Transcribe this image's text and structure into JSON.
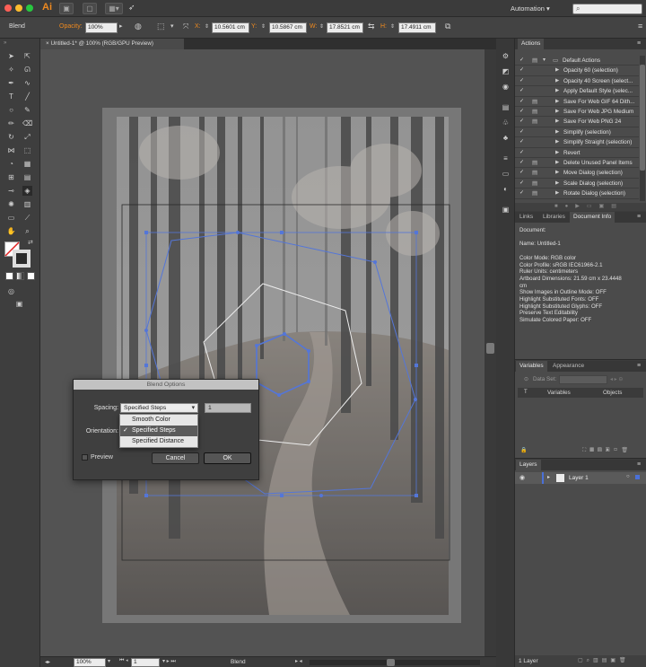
{
  "menubar": {
    "app_icon": "Ai",
    "workspace": "Automation",
    "search_placeholder": "",
    "traffic_colors": [
      "#fc5f57",
      "#fdbc2e",
      "#28c840"
    ]
  },
  "control_bar": {
    "object_type": "Blend",
    "opacity_label": "Opacity:",
    "opacity_value": "100%",
    "x_label": "X:",
    "x_value": "10.5601 cm",
    "y_label": "Y:",
    "y_value": "10.5867 cm",
    "w_label": "W:",
    "w_value": "17.8521 cm",
    "h_label": "H:",
    "h_value": "17.4911 cm"
  },
  "document_tab": {
    "close_glyph": "×",
    "title": "Untitled-1* @ 100% (RGB/GPU Preview)"
  },
  "status_bar": {
    "zoom": "100%",
    "artboard_number": "1",
    "status_text": "Blend"
  },
  "actions_panel": {
    "tab": "Actions",
    "set_name": "Default Actions",
    "items": [
      "Opacity 60 (selection)",
      "Opacity 40 Screen (select...",
      "Apply Default Style (selec...",
      "Save For Web GIF 64 Dith...",
      "Save For Web JPG Medium",
      "Save For Web PNG 24",
      "Simplify (selection)",
      "Simplify Straight (selection)",
      "Revert",
      "Delete Unused Panel Items",
      "Move Dialog (selection)",
      "Scale Dialog (selection)",
      "Rotate Dialog (selection)"
    ]
  },
  "document_info_panel": {
    "tabs": [
      "Links",
      "Libraries",
      "Document Info"
    ],
    "lines": [
      "Document:",
      "",
      "Name: Untitled-1",
      "",
      "Color Mode: RGB color",
      "Color Profile: sRGB IEC61966-2.1",
      "Ruler Units: centimeters",
      "Artboard Dimensions: 21.59 cm x 23.4448",
      "cm",
      "Show Images in Outline Mode: OFF",
      "Highlight Substituted Fonts: OFF",
      "Highlight Substituted Glyphs: OFF",
      "Preserve Text Editability",
      "Simulate Colored Paper: OFF"
    ]
  },
  "variables_panel": {
    "tabs": [
      "Variables",
      "Appearance"
    ],
    "data_set_label": "Data Set:",
    "col_type": "T",
    "col_variables": "Variables",
    "col_objects": "Objects"
  },
  "layers_panel": {
    "tab": "Layers",
    "layer_name": "Layer 1",
    "footer": "1 Layer"
  },
  "blend_dialog": {
    "title": "Blend Options",
    "spacing_label": "Spacing:",
    "spacing_value": "Specified Steps",
    "steps_value": "1",
    "orientation_label": "Orientation:",
    "preview_label": "Preview",
    "cancel": "Cancel",
    "ok": "OK",
    "menu_options": [
      "Smooth Color",
      "Specified Steps",
      "Specified Distance"
    ],
    "menu_selected_index": 1,
    "check_glyph": "✓"
  },
  "colors": {
    "selection_blue": "#4a70d8",
    "app_orange": "#ef8a1f"
  }
}
